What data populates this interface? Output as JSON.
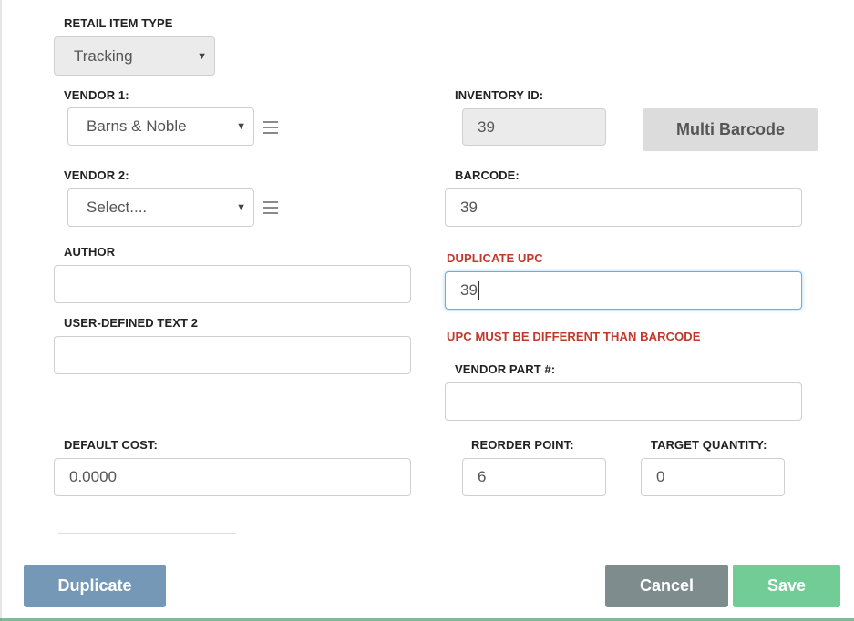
{
  "form": {
    "retail_item_type": {
      "label": "RETAIL ITEM TYPE",
      "value": "Tracking"
    },
    "vendor1": {
      "label": "VENDOR 1:",
      "value": "Barns & Noble"
    },
    "vendor2": {
      "label": "VENDOR 2:",
      "value": "Select...."
    },
    "author": {
      "label": "AUTHOR",
      "value": ""
    },
    "user_defined_text_2": {
      "label": "USER-DEFINED TEXT 2",
      "value": ""
    },
    "default_cost": {
      "label": "DEFAULT COST:",
      "value": "0.0000"
    },
    "inventory_id": {
      "label": "INVENTORY ID:",
      "value": "39"
    },
    "barcode": {
      "label": "BARCODE:",
      "value": "39"
    },
    "duplicate_upc": {
      "label": "DUPLICATE UPC",
      "value": "39",
      "error": "UPC MUST BE DIFFERENT THAN BARCODE"
    },
    "vendor_part": {
      "label": "VENDOR PART #:",
      "value": ""
    },
    "reorder_point": {
      "label": "REORDER POINT:",
      "value": "6"
    },
    "target_quantity": {
      "label": "TARGET QUANTITY:",
      "value": "0"
    }
  },
  "buttons": {
    "multi_barcode": "Multi Barcode",
    "duplicate": "Duplicate",
    "cancel": "Cancel",
    "save": "Save"
  },
  "colors": {
    "error": "#c0392b",
    "duplicate_btn": "#7598b7",
    "cancel_btn": "#7f8c8d",
    "save_btn": "#72cc96",
    "multi_barcode_btn": "#dcdcdc"
  }
}
